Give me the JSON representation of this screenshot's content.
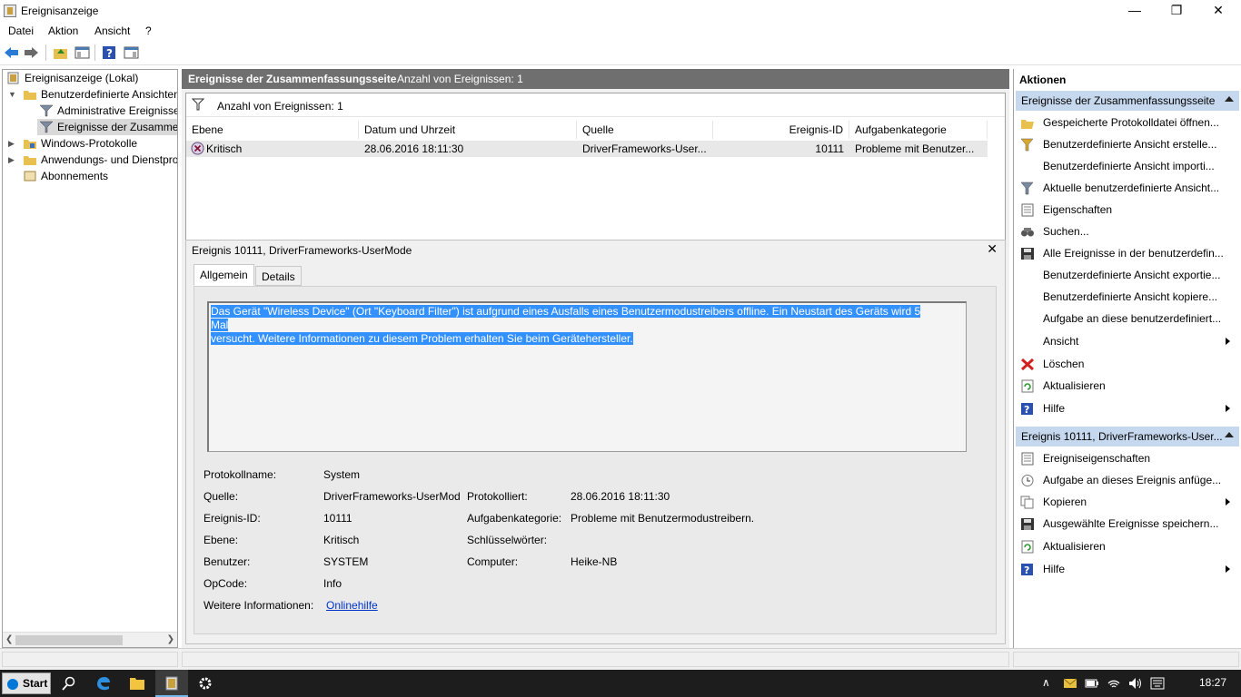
{
  "window": {
    "title": "Ereignisanzeige"
  },
  "menu": [
    "Datei",
    "Aktion",
    "Ansicht",
    "?"
  ],
  "tree": {
    "root": "Ereignisanzeige (Lokal)",
    "custom_views": "Benutzerdefinierte Ansichten",
    "admin_events": "Administrative Ereignisse",
    "summary_events": "Ereignisse der Zusammenfassungsseite",
    "windows_logs": "Windows-Protokolle",
    "apps_services": "Anwendungs- und Dienstprotokolle",
    "subscriptions": "Abonnements"
  },
  "center": {
    "header_title": "Ereignisse der Zusammenfassungsseite",
    "header_count": "Anzahl von Ereignissen: 1",
    "filter_count": "Anzahl von Ereignissen: 1",
    "columns": [
      "Ebene",
      "Datum und Uhrzeit",
      "Quelle",
      "Ereignis-ID",
      "Aufgabenkategorie"
    ],
    "row": {
      "level": "Kritisch",
      "datetime": "28.06.2016 18:11:30",
      "source": "DriverFrameworks-User...",
      "event_id": "10111",
      "category": "Probleme mit Benutzer..."
    }
  },
  "detail": {
    "title": "Ereignis 10111, DriverFrameworks-UserMode",
    "tabs": [
      "Allgemein",
      "Details"
    ],
    "description_line1": "Das Gerät \"Wireless Device\" (Ort \"Keyboard Filter\") ist aufgrund eines Ausfalls eines Benutzermodustreibers offline. Ein Neustart des Geräts wird 5 Mal",
    "description_line2": "versucht. Weitere Informationen zu diesem Problem erhalten Sie beim Gerätehersteller.",
    "fields": {
      "log_name_label": "Protokollname:",
      "log_name": "System",
      "source_label": "Quelle:",
      "source": "DriverFrameworks-UserMod",
      "logged_label": "Protokolliert:",
      "logged": "28.06.2016 18:11:30",
      "event_id_label": "Ereignis-ID:",
      "event_id": "10111",
      "task_label": "Aufgabenkategorie:",
      "task": "Probleme mit Benutzermodustreibern.",
      "level_label": "Ebene:",
      "level": "Kritisch",
      "keywords_label": "Schlüsselwörter:",
      "keywords": "",
      "user_label": "Benutzer:",
      "user": "SYSTEM",
      "computer_label": "Computer:",
      "computer": "Heike-NB",
      "opcode_label": "OpCode:",
      "opcode": "Info",
      "more_info_label": "Weitere Informationen:",
      "more_info_link": "Onlinehilfe"
    }
  },
  "actions": {
    "header": "Aktionen",
    "section1": "Ereignisse der Zusammenfassungsseite",
    "items1": [
      "Gespeicherte Protokolldatei öffnen...",
      "Benutzerdefinierte Ansicht erstelle...",
      "Benutzerdefinierte Ansicht importi...",
      "Aktuelle benutzerdefinierte Ansicht...",
      "Eigenschaften",
      "Suchen...",
      "Alle Ereignisse in der benutzerdefin...",
      "Benutzerdefinierte Ansicht exportie...",
      "Benutzerdefinierte Ansicht kopiere...",
      "Aufgabe an diese benutzerdefiniert...",
      "Ansicht",
      "Löschen",
      "Aktualisieren",
      "Hilfe"
    ],
    "section2": "Ereignis 10111, DriverFrameworks-User...",
    "items2": [
      "Ereigniseigenschaften",
      "Aufgabe an dieses Ereignis anfüge...",
      "Kopieren",
      "Ausgewählte Ereignisse speichern...",
      "Aktualisieren",
      "Hilfe"
    ]
  },
  "taskbar": {
    "start": "Start",
    "clock": "18:27"
  },
  "colors": {
    "accent_header": "#6f6f6f",
    "section_bg": "#c6d8ee",
    "selection": "#3390ff",
    "critical": "#c0305a"
  }
}
